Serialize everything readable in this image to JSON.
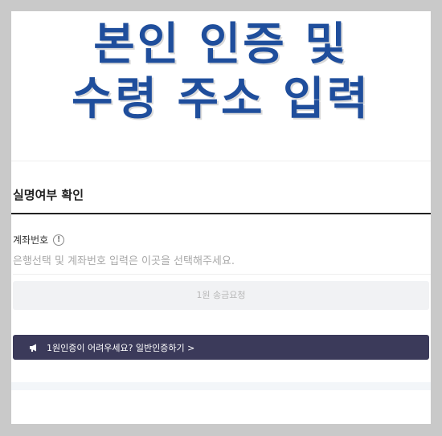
{
  "headline": {
    "line1": "본인 인증 및",
    "line2": "수령 주소 입력"
  },
  "verification": {
    "section_title": "실명여부 확인",
    "account_label": "계좌번호",
    "info_icon_glyph": "!",
    "account_placeholder": "은행선택 및 계좌번호 입력은 이곳을 선택해주세요.",
    "send_button_label": "1원 송금요청",
    "alt_banner_label": "1원인증이 어려우세요? 일반인증하기 >"
  },
  "colors": {
    "headline": "#1f4e9c",
    "banner_bg": "#3b3a5a",
    "button_bg": "#f1f2f4",
    "outer_bg": "#c9c9c9"
  },
  "icons": {
    "info": "info-circle-icon",
    "banner": "megaphone-icon"
  }
}
